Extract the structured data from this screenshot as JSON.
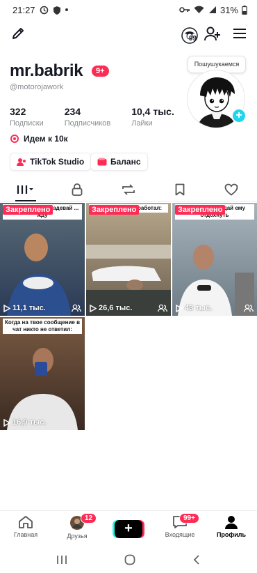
{
  "status_bar": {
    "time": "21:27",
    "battery": "31%"
  },
  "header": {
    "avatar_badge": "99"
  },
  "profile": {
    "username": "mr.babrik",
    "notif_badge": "9+",
    "handle": "@motorojawork",
    "tooltip": "Пошушукаемся",
    "stats": [
      {
        "value": "322",
        "label": "Подписки"
      },
      {
        "value": "234",
        "label": "Подписчиков"
      },
      {
        "value": "10,4 тыс.",
        "label": "Лайки"
      }
    ],
    "bio": "Идем к 10к",
    "buttons": {
      "studio": "TikTok Studio",
      "balance": "Баланс"
    }
  },
  "tabs": [
    "videos",
    "private",
    "reposts",
    "favorites",
    "liked"
  ],
  "videos": [
    {
      "pinned": "Закреплено",
      "caption": "Папа: вдалай и надевай ... жду",
      "views": "11,1 тыс.",
      "colors": [
        "#5a6b78",
        "#2a3a55"
      ]
    },
    {
      "pinned": "Закреплено",
      "caption": "будильник не сработал:",
      "views": "26,6 тыс.",
      "colors": [
        "#b8a78c",
        "#6b5f4e"
      ]
    },
    {
      "pinned": "Закреплено",
      "caption": "Мама: ...ation. дай ему отдохнуть",
      "views": "43 тыс.",
      "colors": [
        "#a8b4bc",
        "#6d7b86"
      ]
    },
    {
      "pinned": "",
      "caption": "Когда на твое сообщение в чат никто не ответил:",
      "views": "16,9 тыс.",
      "colors": [
        "#7a5b43",
        "#3a2a22"
      ]
    }
  ],
  "bottom_nav": {
    "home": "Главная",
    "friends": "Друзья",
    "friends_badge": "12",
    "inbox": "Входящие",
    "inbox_badge": "99+",
    "profile": "Профиль"
  }
}
